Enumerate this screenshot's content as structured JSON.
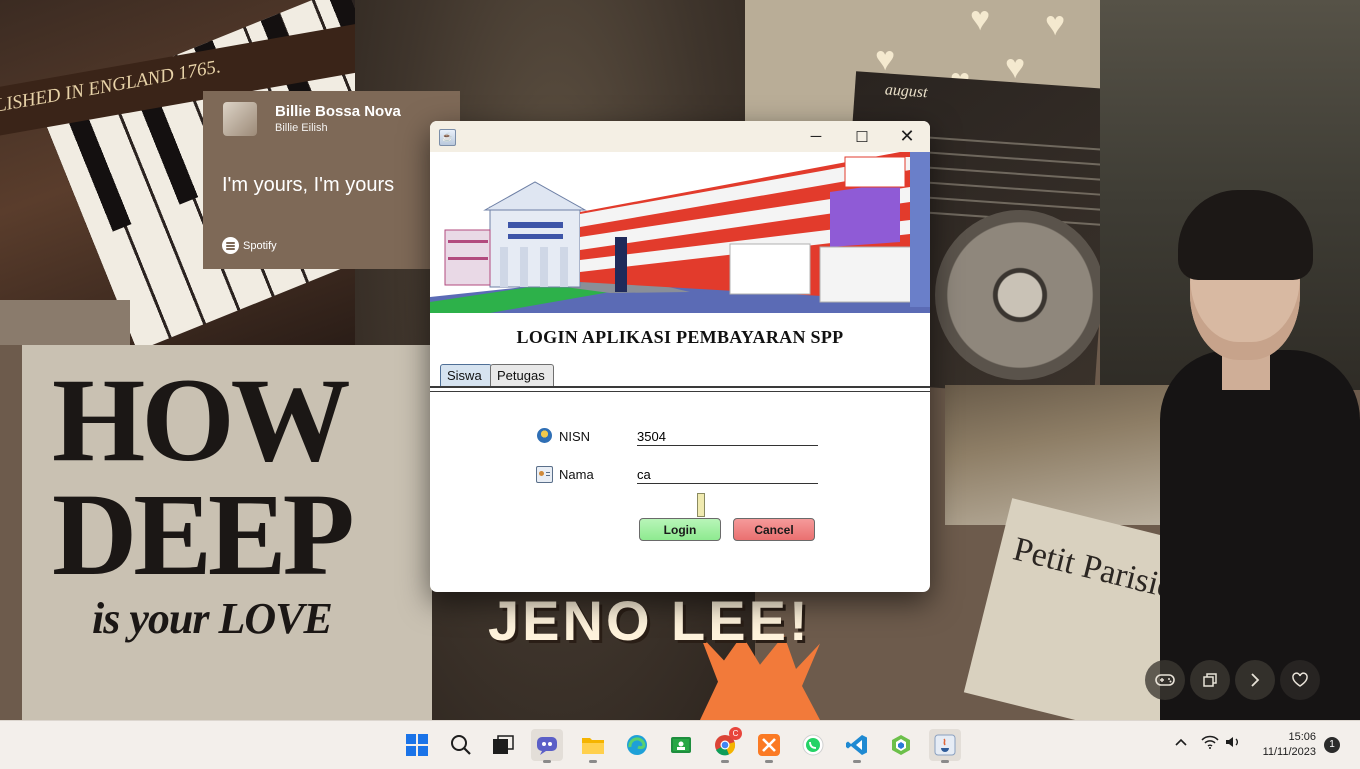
{
  "wallpaper": {
    "piano_text": "LISHED IN ENGLAND 1765.",
    "how": "HOW",
    "deep": "DEEP",
    "is_your_love": "is your LOVE",
    "jeno": "JENO LEE!",
    "newspaper": "Petit Parisien",
    "letter_title": "august"
  },
  "spotify_widget": {
    "song": "Billie Bossa Nova",
    "artist": "Billie Eilish",
    "lyric": "I'm yours, I'm yours",
    "brand": "Spotify"
  },
  "media_controls": {
    "icons": [
      "gamepad-icon",
      "copy-icon",
      "chevron-right-icon",
      "heart-icon"
    ]
  },
  "window": {
    "minimize_glyph": "─",
    "maximize_glyph": "☐",
    "close_glyph": "✕",
    "login_title": "LOGIN APLIKASI PEMBAYARAN SPP",
    "tabs": [
      {
        "label": "Siswa",
        "selected": true
      },
      {
        "label": "Petugas",
        "selected": false
      }
    ],
    "form": {
      "nisn_label": "NISN",
      "nisn_value": "3504",
      "nama_label": "Nama",
      "nama_value": "ca",
      "login_button": "Login",
      "cancel_button": "Cancel"
    }
  },
  "taskbar": {
    "icons": [
      "windows-start-icon",
      "search-icon",
      "task-view-icon",
      "teams-chat-icon",
      "file-explorer-icon",
      "edge-browser-icon",
      "classroom-icon",
      "chrome-icon",
      "xampp-icon",
      "whatsapp-icon",
      "vscode-icon",
      "app-hexagon-icon",
      "java-icon"
    ],
    "time": "15:06",
    "date": "11/11/2023",
    "notifications": "1",
    "chrome_badge": "C"
  }
}
